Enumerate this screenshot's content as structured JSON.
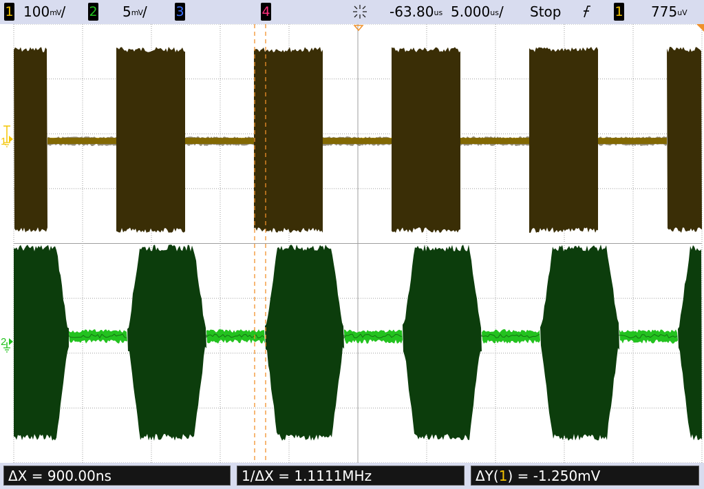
{
  "colors": {
    "channel1": "#f4c400",
    "channel1_trace": "#3a2e06",
    "channel1_baseline": "#d9b000",
    "channel2": "#23c21f",
    "channel2_trace": "#0c3d0c",
    "channel3": "#3b6fff",
    "channel4": "#ff2f7d",
    "cursor": "#f0902a",
    "grid": "#9e9e9e"
  },
  "status_bar": {
    "ch1_number": "1",
    "ch1_scale": "100",
    "ch1_unit": "mV",
    "ch2_number": "2",
    "ch2_scale": "5",
    "ch2_unit": "mV",
    "ch3_number": "3",
    "ch4_number": "4",
    "acq_icon": "acquisition-sparkle-icon",
    "time_offset": "-63.80",
    "time_offset_unit": "us",
    "timebase": "5.000",
    "timebase_unit": "us",
    "run_state": "Stop",
    "trigger_edge_icon": "rising-edge-icon",
    "trigger_source": "1",
    "trigger_level": "775",
    "trigger_level_unit": "uV"
  },
  "markers": {
    "ch1": "1",
    "ch2": "2"
  },
  "measurements": {
    "delta_x": "ΔX = 900.00ns",
    "inv_delta_x": "1/ΔX = 1.1111MHz",
    "delta_y_prefix": "ΔY(",
    "delta_y_channel": "1",
    "delta_y_suffix": ") = -1.250mV"
  }
}
